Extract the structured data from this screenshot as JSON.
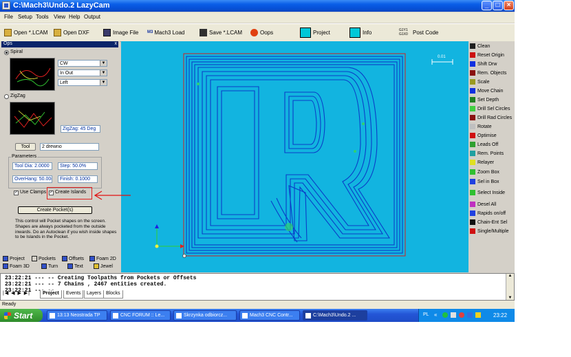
{
  "window": {
    "title": "C:\\Mach3\\Undo.2 LazyCam",
    "minimize": "_",
    "maximize": "□",
    "close": "×"
  },
  "menu": [
    "File",
    "Setup",
    "Tools",
    "View",
    "Help",
    "Output"
  ],
  "toolbar": {
    "open_lcam": "Open *.LCAM",
    "open_dxf": "Open DXF",
    "image_file": "Image File",
    "mach3_load_badge": "M3",
    "mach3_load": "Mach3 Load",
    "save_lcam": "Save *.LCAM",
    "oops": "Oops",
    "project": "Project",
    "info": "Info",
    "post_code_badge": "G1Y1 G1X0",
    "post_code": "Post Code"
  },
  "ops": {
    "title": "Ops",
    "spiral_label": "Spiral",
    "direction": "CW",
    "mode": "In Out",
    "side": "Left",
    "zigzag_label": "ZigZag",
    "zigzag_field": "ZigZag: 45 Deg",
    "tool_button": "Tool",
    "tool_value": "2 drewno",
    "parameters_label": "Parameters",
    "tool_dia": "Tool Dia: 2.0000",
    "step": "Step: 50.0%",
    "overhang": "OverHang: 50.00(",
    "finish": "Finish: 0.1000",
    "use_clamps": "Use Clamps",
    "create_islands": "Create Islands",
    "create_pockets": "Create Pocket(s)",
    "description": "This control will Pocket shapes on the screen. Shapes are always pocketed from the outside inwards. Do an Autoclean if you wish inside shapes to be Islands in the Pocket."
  },
  "panel_tabs": [
    "Project",
    "Pockets",
    "Offsets",
    "Foam 2D",
    "Foam 3D",
    "Turn",
    "Text",
    "Jewel"
  ],
  "right_buttons": [
    {
      "label": "Clean",
      "color": "#1f1f1f"
    },
    {
      "label": "Reset Origin",
      "color": "#cc1010"
    },
    {
      "label": "Shift Drw",
      "color": "#1030e0"
    },
    {
      "label": "Rem. Objects",
      "color": "#8a1010"
    },
    {
      "label": "Scale",
      "color": "#9a9a20"
    },
    {
      "label": "Move Chain",
      "color": "#1030e0"
    },
    {
      "label": "Set Depth",
      "color": "#208020"
    },
    {
      "label": "Drill Sel Circles",
      "color": "#40d040"
    },
    {
      "label": "Drill Rad Circles",
      "color": "#8a1010"
    },
    {
      "label": "Rotate",
      "color": "#c0c0c0"
    },
    {
      "label": "Optimise",
      "color": "#d01010"
    },
    {
      "label": "Leads Off",
      "color": "#30a030"
    },
    {
      "label": "Rem. Points",
      "color": "#20a0a0"
    },
    {
      "label": "Relayer",
      "color": "#e0e020"
    },
    {
      "label": "Zoom Box",
      "color": "#30c030"
    },
    {
      "label": "Sel in Box",
      "color": "#2040e0"
    },
    {
      "label": "Select Inside",
      "color": "#30c030"
    },
    {
      "label": "Desel All",
      "color": "#c030c0"
    },
    {
      "label": "Rapids on/off",
      "color": "#2040e0"
    },
    {
      "label": "Chain-Ent Sel",
      "color": "#101010"
    },
    {
      "label": "Single/Multiple",
      "color": "#d01010"
    }
  ],
  "canvas": {
    "scale_label": "0.01"
  },
  "output": {
    "lines": [
      "23:22:21 --- --   Creating Toolpaths from Pockets or Offsets",
      "23:22:21 --- --   7 Chains , 2467 entities created.",
      "23:22:21 --- --"
    ]
  },
  "bottom_tabs": [
    "Project",
    "Events",
    "Layers",
    "Blocks"
  ],
  "status": "Ready",
  "taskbar": {
    "start": "Start",
    "tasks": [
      "13:13 Neostrada TP",
      "CNC FORUM :: Le...",
      "Skrzynka odbiorcz...",
      "Mach3 CNC Contr...",
      "C:\\Mach3\\Undo.2 ..."
    ],
    "lang": "PL",
    "clock": "23:22"
  },
  "colors": {
    "canvas_bg": "#12b4e0",
    "toolpath": "#0a3cc8",
    "border_line": "#d02020",
    "annotation_arrow": "#e01010",
    "highlight_box": "#e02020"
  }
}
